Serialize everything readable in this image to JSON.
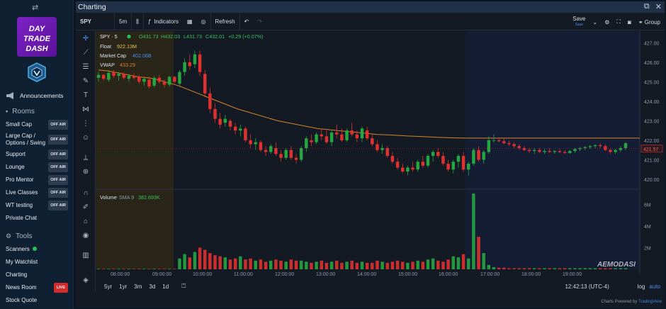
{
  "sidebar": {
    "collapse_icon": "collapse-arrows-icon",
    "logo_text": [
      "DAY",
      "TRADE",
      "DASH"
    ],
    "items": [
      {
        "label": "Announcements"
      }
    ],
    "rooms_title": "Rooms",
    "rooms": [
      {
        "label": "Small Cap",
        "status": "OFF AIR"
      },
      {
        "label": "Large Cap / Options / Swing",
        "status": "OFF AIR"
      },
      {
        "label": "Support",
        "status": "OFF AIR"
      },
      {
        "label": "Lounge",
        "status": "OFF AIR"
      },
      {
        "label": "Pro Mentor",
        "status": "OFF AIR"
      },
      {
        "label": "Live Classes",
        "status": "OFF AIR"
      },
      {
        "label": "WT testing",
        "status": "OFF AIR"
      },
      {
        "label": "Private Chat",
        "status": ""
      }
    ],
    "tools_title": "Tools",
    "tools": [
      {
        "label": "Scanners",
        "status": ""
      },
      {
        "label": "My Watchlist",
        "status": ""
      },
      {
        "label": "Charting",
        "status": ""
      },
      {
        "label": "News Room",
        "status": "LIVE"
      },
      {
        "label": "Stock Quote",
        "status": ""
      }
    ]
  },
  "window": {
    "title": "Charting",
    "toolbar": {
      "symbol": "SPY",
      "interval": "5m",
      "indicators": "Indicators",
      "refresh": "Refresh",
      "save": "Save",
      "save_sub": "Save",
      "group": "Group"
    }
  },
  "chart_legend": {
    "symbol": "SPY · 5",
    "o": "O431.73",
    "h": "H432.03",
    "l": "L431.73",
    "c": "C432.01",
    "chg": "+0.29 (+0.07%)",
    "float_label": "Float",
    "float_value": "922.13M",
    "mcap_label": "Market Cap",
    "mcap_value": "402.06B",
    "vwap_label": "VWAP",
    "vwap_value": "433.29",
    "volume_label": "Volume",
    "sma_label": "SMA 9",
    "volume_value": "382.693K"
  },
  "bottom": {
    "ranges": [
      "5yr",
      "1yr",
      "3m",
      "3d",
      "1d"
    ],
    "time": "12:42:13 (UTC-4)",
    "log": "log",
    "auto": "auto",
    "credit_prefix": "Charts Powered by",
    "credit_brand": "TradingView",
    "watermark": "AEMODASI"
  },
  "colors": {
    "up": "#26a641",
    "down": "#e0312e",
    "vwap": "#d9822b",
    "accent": "#4b8df0"
  },
  "chart_data": {
    "type": "candlestick",
    "x_labels": [
      "08:00:00",
      "09:00:00",
      "10:00:00",
      "11:00:00",
      "12:00:00",
      "13:00:00",
      "14:00:00",
      "15:00:00",
      "16:00:00",
      "17:00:00",
      "18:00:00",
      "19:00:00"
    ],
    "price_ticks": [
      "427.00",
      "426.00",
      "425.00",
      "424.00",
      "423.00",
      "422.00",
      "421.00",
      "420.00"
    ],
    "price_ylim": [
      419.6,
      427.3
    ],
    "last_price_label": "421.57",
    "vwap_level": "422.11",
    "volume_ticks": [
      "6M",
      "4M",
      "2M"
    ],
    "volume_ylim": [
      0,
      7.2
    ],
    "candles": [
      [
        425.2,
        425.5,
        425.0,
        425.35
      ],
      [
        425.35,
        425.4,
        425.05,
        425.15
      ],
      [
        425.1,
        425.6,
        425.0,
        425.45
      ],
      [
        425.5,
        425.6,
        425.2,
        425.3
      ],
      [
        425.3,
        425.5,
        425.05,
        425.4
      ],
      [
        425.4,
        425.5,
        425.1,
        425.2
      ],
      [
        425.15,
        425.4,
        425.0,
        425.3
      ],
      [
        425.3,
        425.45,
        425.1,
        425.2
      ],
      [
        425.25,
        425.35,
        424.9,
        425.0
      ],
      [
        425.0,
        425.2,
        424.8,
        425.15
      ],
      [
        425.1,
        425.25,
        424.65,
        424.75
      ],
      [
        424.8,
        425.3,
        424.7,
        425.2
      ],
      [
        425.2,
        425.35,
        424.9,
        425.0
      ],
      [
        425.0,
        425.1,
        424.7,
        424.85
      ],
      [
        424.85,
        425.3,
        424.75,
        425.25
      ],
      [
        425.25,
        425.3,
        424.9,
        425.0
      ],
      [
        424.9,
        425.6,
        424.8,
        425.5
      ],
      [
        425.5,
        426.2,
        425.3,
        426.0
      ],
      [
        426.0,
        426.4,
        425.6,
        425.8
      ],
      [
        425.9,
        426.6,
        425.7,
        426.4
      ],
      [
        426.4,
        426.6,
        425.3,
        425.5
      ],
      [
        425.4,
        425.6,
        424.2,
        424.4
      ],
      [
        424.4,
        424.7,
        423.4,
        423.6
      ],
      [
        423.6,
        423.9,
        422.9,
        423.1
      ],
      [
        423.1,
        423.4,
        422.6,
        422.8
      ],
      [
        422.9,
        423.3,
        422.7,
        423.1
      ],
      [
        423.0,
        423.1,
        422.5,
        422.7
      ],
      [
        422.7,
        422.9,
        422.3,
        422.5
      ],
      [
        422.5,
        422.8,
        422.2,
        422.6
      ],
      [
        422.6,
        422.7,
        421.9,
        422.0
      ],
      [
        422.0,
        422.3,
        421.6,
        421.8
      ],
      [
        421.8,
        422.1,
        421.5,
        421.9
      ],
      [
        421.9,
        422.0,
        421.4,
        421.5
      ],
      [
        421.5,
        421.7,
        421.2,
        421.4
      ],
      [
        421.4,
        421.8,
        421.3,
        421.7
      ],
      [
        421.6,
        421.9,
        421.2,
        421.3
      ],
      [
        421.3,
        421.5,
        420.9,
        421.1
      ],
      [
        421.1,
        421.6,
        421.0,
        421.5
      ],
      [
        421.5,
        421.7,
        421.0,
        421.1
      ],
      [
        421.1,
        421.3,
        420.8,
        421.0
      ],
      [
        421.0,
        421.7,
        420.9,
        421.6
      ],
      [
        421.6,
        422.2,
        421.4,
        422.1
      ],
      [
        422.0,
        422.3,
        421.7,
        421.9
      ],
      [
        421.9,
        422.4,
        421.8,
        422.3
      ],
      [
        422.3,
        422.6,
        422.0,
        422.2
      ],
      [
        422.2,
        422.5,
        421.8,
        421.9
      ],
      [
        421.9,
        422.5,
        421.7,
        422.4
      ],
      [
        422.4,
        422.8,
        422.1,
        422.3
      ],
      [
        422.3,
        422.6,
        421.9,
        422.0
      ],
      [
        422.0,
        422.6,
        421.9,
        422.5
      ],
      [
        422.5,
        422.9,
        422.2,
        422.3
      ],
      [
        422.3,
        422.5,
        421.9,
        422.1
      ],
      [
        422.1,
        422.7,
        421.9,
        422.6
      ],
      [
        422.5,
        422.7,
        422.0,
        422.1
      ],
      [
        422.1,
        422.3,
        421.7,
        421.8
      ],
      [
        421.8,
        422.0,
        421.4,
        421.5
      ],
      [
        421.5,
        421.8,
        421.3,
        421.6
      ],
      [
        421.6,
        421.7,
        421.1,
        421.2
      ],
      [
        421.2,
        421.4,
        420.8,
        420.9
      ],
      [
        420.9,
        421.1,
        420.5,
        420.6
      ],
      [
        420.6,
        420.8,
        420.3,
        420.4
      ],
      [
        420.4,
        420.7,
        420.2,
        420.6
      ],
      [
        420.6,
        420.9,
        420.4,
        420.5
      ],
      [
        420.5,
        421.0,
        420.4,
        420.9
      ],
      [
        420.9,
        421.2,
        420.6,
        420.7
      ],
      [
        420.7,
        421.3,
        420.6,
        421.2
      ],
      [
        421.2,
        421.5,
        420.9,
        421.4
      ],
      [
        421.4,
        421.6,
        421.1,
        421.2
      ],
      [
        421.2,
        421.4,
        420.7,
        420.8
      ],
      [
        420.8,
        421.0,
        420.4,
        420.5
      ],
      [
        420.5,
        421.0,
        420.3,
        420.9
      ],
      [
        420.9,
        421.3,
        420.6,
        421.2
      ],
      [
        421.2,
        421.4,
        420.4,
        420.5
      ],
      [
        420.5,
        420.9,
        420.2,
        420.8
      ],
      [
        420.8,
        421.6,
        420.7,
        421.5
      ],
      [
        421.5,
        421.7,
        420.9,
        421.0
      ],
      [
        421.0,
        421.5,
        420.8,
        421.4
      ],
      [
        421.4,
        422.2,
        421.3,
        422.0
      ],
      [
        422.0,
        422.3,
        421.9,
        422.0
      ],
      [
        422.0,
        422.1,
        421.9,
        421.95
      ],
      [
        421.95,
        422.1,
        421.8,
        421.85
      ],
      [
        421.85,
        422.0,
        421.7,
        421.8
      ],
      [
        421.8,
        421.9,
        421.6,
        421.7
      ],
      [
        421.7,
        421.8,
        421.5,
        421.6
      ],
      [
        421.6,
        421.7,
        421.45,
        421.5
      ],
      [
        421.5,
        421.6,
        421.35,
        421.45
      ],
      [
        421.45,
        421.6,
        421.3,
        421.5
      ],
      [
        421.5,
        421.6,
        421.35,
        421.4
      ],
      [
        421.4,
        421.55,
        421.3,
        421.45
      ],
      [
        421.45,
        421.6,
        421.35,
        421.4
      ],
      [
        421.4,
        421.5,
        421.3,
        421.45
      ],
      [
        421.45,
        421.55,
        421.35,
        421.4
      ],
      [
        421.4,
        421.5,
        421.3,
        421.35
      ],
      [
        421.35,
        421.5,
        421.3,
        421.45
      ],
      [
        421.45,
        421.6,
        421.35,
        421.55
      ],
      [
        421.55,
        421.65,
        421.45,
        421.6
      ],
      [
        421.6,
        421.7,
        421.5,
        421.65
      ],
      [
        421.65,
        421.75,
        421.55,
        421.7
      ],
      [
        421.7,
        421.8,
        421.6,
        421.75
      ],
      [
        421.75,
        421.85,
        421.6,
        421.7
      ],
      [
        421.7,
        421.8,
        421.45,
        421.5
      ],
      [
        421.5,
        421.6,
        421.3,
        421.4
      ],
      [
        421.4,
        421.55,
        421.3,
        421.5
      ],
      [
        421.5,
        421.7,
        421.4,
        421.6
      ],
      [
        421.6,
        421.9,
        421.5,
        421.85
      ]
    ],
    "volume": [
      0.05,
      0.05,
      0.05,
      0.05,
      0.05,
      0.05,
      0.05,
      0.05,
      0.05,
      0.05,
      0.05,
      0.05,
      0.05,
      0.05,
      0.05,
      0.05,
      1.0,
      1.4,
      1.1,
      1.6,
      2.0,
      1.8,
      1.5,
      1.3,
      1.2,
      1.1,
      0.9,
      1.0,
      1.2,
      0.9,
      1.0,
      0.8,
      0.9,
      0.7,
      0.8,
      0.9,
      0.8,
      0.7,
      0.9,
      0.8,
      0.8,
      0.7,
      0.6,
      0.7,
      0.8,
      0.6,
      0.7,
      0.8,
      0.6,
      0.7,
      0.8,
      0.6,
      0.7,
      0.6,
      0.6,
      0.8,
      0.7,
      0.6,
      0.7,
      0.8,
      0.7,
      0.6,
      0.7,
      0.8,
      0.7,
      0.9,
      1.0,
      0.8,
      0.7,
      0.9,
      1.2,
      1.1,
      1.4,
      1.0,
      7.0,
      3.0,
      1.5,
      0.4,
      0.2,
      0.15,
      0.15,
      0.1,
      0.1,
      0.1,
      0.1,
      0.1,
      0.1,
      0.1,
      0.1,
      0.1,
      0.1,
      0.1,
      0.1,
      0.1,
      0.1,
      0.1,
      0.1,
      0.1,
      0.1,
      0.1,
      0.1,
      0.1,
      0.1,
      0.1,
      0.1
    ],
    "vwap_series": [
      425.6,
      425.55,
      425.45,
      425.35,
      425.25,
      425.2,
      425.1,
      424.95,
      424.8,
      424.6,
      424.4,
      424.2,
      424.0,
      423.8,
      423.6,
      423.45,
      423.3,
      423.15,
      423.0,
      422.9,
      422.8,
      422.7,
      422.6,
      422.55,
      422.5,
      422.45,
      422.4,
      422.35,
      422.3,
      422.28,
      422.25,
      422.22,
      422.2,
      422.18,
      422.15,
      422.13,
      422.12,
      422.11
    ]
  }
}
